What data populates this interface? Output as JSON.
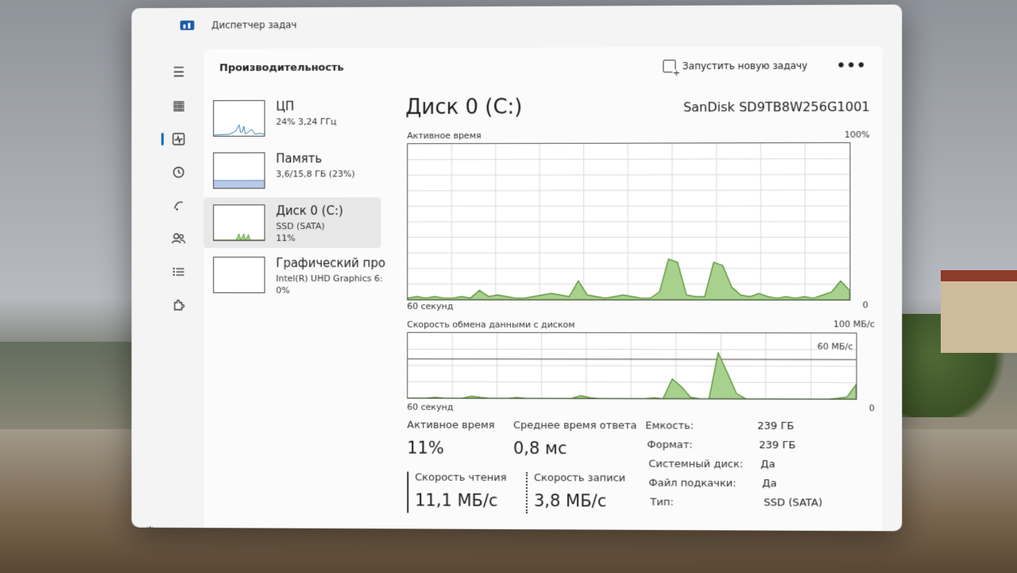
{
  "window": {
    "title": "Диспетчер задач"
  },
  "header": {
    "page_title": "Производительность",
    "new_task_label": "Запустить новую задачу",
    "more_label": "•••"
  },
  "sidebar": {
    "items": [
      {
        "name": "ЦП",
        "sub": "24% 3,24 ГГц",
        "sub2": ""
      },
      {
        "name": "Память",
        "sub": "3,6/15,8 ГБ (23%)",
        "sub2": ""
      },
      {
        "name": "Диск 0 (C:)",
        "sub": "SSD (SATA)",
        "sub2": "11%"
      },
      {
        "name": "Графический про",
        "sub": "Intel(R) UHD Graphics 6:",
        "sub2": "0%"
      }
    ]
  },
  "main": {
    "title": "Диск 0 (C:)",
    "model": "SanDisk SD9TB8W256G1001",
    "active_graph": {
      "label": "Активное время",
      "max_label": "100%",
      "left_label": "60 секунд",
      "right_label": "0",
      "values": [
        1,
        2,
        1,
        2,
        1,
        1,
        2,
        1,
        6,
        2,
        3,
        2,
        1,
        1,
        2,
        3,
        4,
        3,
        2,
        12,
        3,
        2,
        1,
        2,
        3,
        2,
        1,
        1,
        5,
        26,
        24,
        3,
        2,
        2,
        24,
        22,
        8,
        3,
        2,
        4,
        2,
        1,
        2,
        1,
        2,
        1,
        3,
        5,
        12,
        6
      ]
    },
    "transfer_graph": {
      "label": "Скорость обмена данными с диском",
      "max_label": "100 МБ/с",
      "mid_label": "60 МБ/с",
      "left_label": "60 секунд",
      "right_label": "0",
      "values": [
        0,
        0,
        0,
        1,
        0,
        0,
        0,
        3,
        1,
        0,
        0,
        0,
        1,
        0,
        0,
        0,
        0,
        0,
        0,
        4,
        1,
        0,
        0,
        0,
        0,
        0,
        0,
        1,
        0,
        30,
        18,
        2,
        0,
        0,
        70,
        40,
        8,
        0,
        0,
        0,
        0,
        0,
        0,
        0,
        0,
        0,
        0,
        1,
        3,
        22
      ]
    },
    "stats": {
      "active_label": "Активное время",
      "active_value": "11%",
      "response_label": "Среднее время ответа",
      "response_value": "0,8 мс",
      "read_label": "Скорость чтения",
      "read_value": "11,1 МБ/с",
      "write_label": "Скорость записи",
      "write_value": "3,8 МБ/с"
    },
    "props": [
      {
        "key": "Емкость:",
        "value": "239 ГБ"
      },
      {
        "key": "Формат:",
        "value": "239 ГБ"
      },
      {
        "key": "Системный диск:",
        "value": "Да"
      },
      {
        "key": "Файл подкачки:",
        "value": "Да"
      },
      {
        "key": "Тип:",
        "value": "SSD (SATA)"
      }
    ]
  },
  "colors": {
    "accent": "#0067c0",
    "disk_fill": "#a9d18e",
    "disk_line": "#4f8a2b",
    "memory_fill": "#b7c9e6",
    "cpu_line": "#2f7fb4"
  }
}
